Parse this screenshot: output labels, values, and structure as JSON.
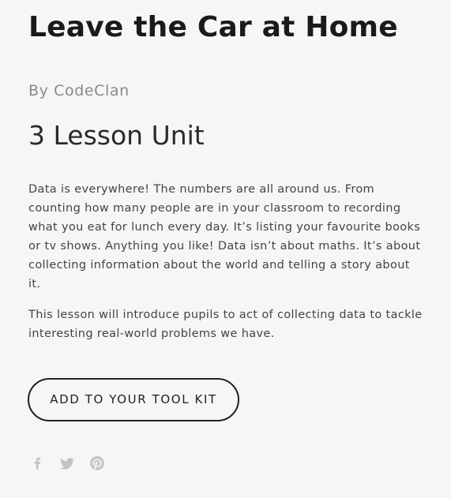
{
  "product": {
    "title": "Leave the Car at Home",
    "byline": "By CodeClan",
    "unit": "3 Lesson Unit",
    "description": [
      "Data is everywhere! The numbers are all around us. From counting how many people are in your classroom to recording what you eat for lunch every day. It’s listing your favourite books or tv shows. Anything you like! Data isn’t about maths. It’s about collecting information about the world and telling a story about it.",
      "This lesson will introduce pupils to act of collecting data to tackle interesting real-world problems we have."
    ],
    "button_label": "ADD TO YOUR TOOL KIT"
  },
  "share": {
    "icons": [
      "facebook-icon",
      "twitter-icon",
      "pinterest-icon"
    ],
    "icon_color": "#c4c4c4"
  },
  "colors": {
    "background": "#f6f6f6",
    "text": "#222222",
    "muted": "#8a8a8a"
  }
}
